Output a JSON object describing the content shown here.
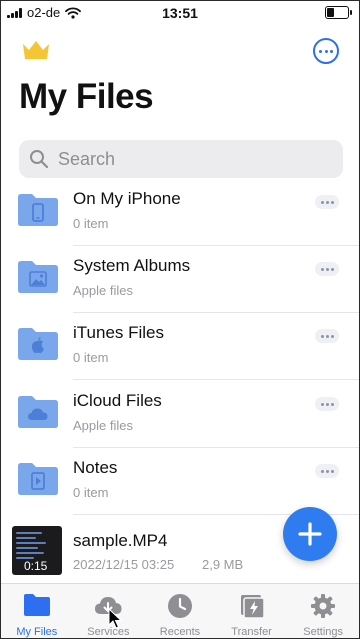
{
  "status_bar": {
    "carrier": "o2-de",
    "time": "13:51"
  },
  "header": {
    "title": "My Files"
  },
  "search": {
    "placeholder": "Search"
  },
  "items": [
    {
      "name": "On My iPhone",
      "sub": "0 item",
      "icon": "phone-icon"
    },
    {
      "name": "System Albums",
      "sub": "Apple files",
      "icon": "photo-icon"
    },
    {
      "name": "iTunes Files",
      "sub": "0 item",
      "icon": "apple-icon"
    },
    {
      "name": "iCloud Files",
      "sub": "Apple files",
      "icon": "cloud-icon"
    },
    {
      "name": "Notes",
      "sub": "0 item",
      "icon": "notes-icon"
    }
  ],
  "video": {
    "name": "sample.MP4",
    "date": "2022/12/15 03:25",
    "size": "2,9 MB",
    "duration": "0:15"
  },
  "tabs": [
    {
      "label": "My Files",
      "active": true
    },
    {
      "label": "Services",
      "active": false
    },
    {
      "label": "Recents",
      "active": false
    },
    {
      "label": "Transfer",
      "active": false
    },
    {
      "label": "Settings",
      "active": false
    }
  ],
  "colors": {
    "accent": "#2d6ff0",
    "folder": "#7aa6ec",
    "crown": "#f4c534"
  }
}
